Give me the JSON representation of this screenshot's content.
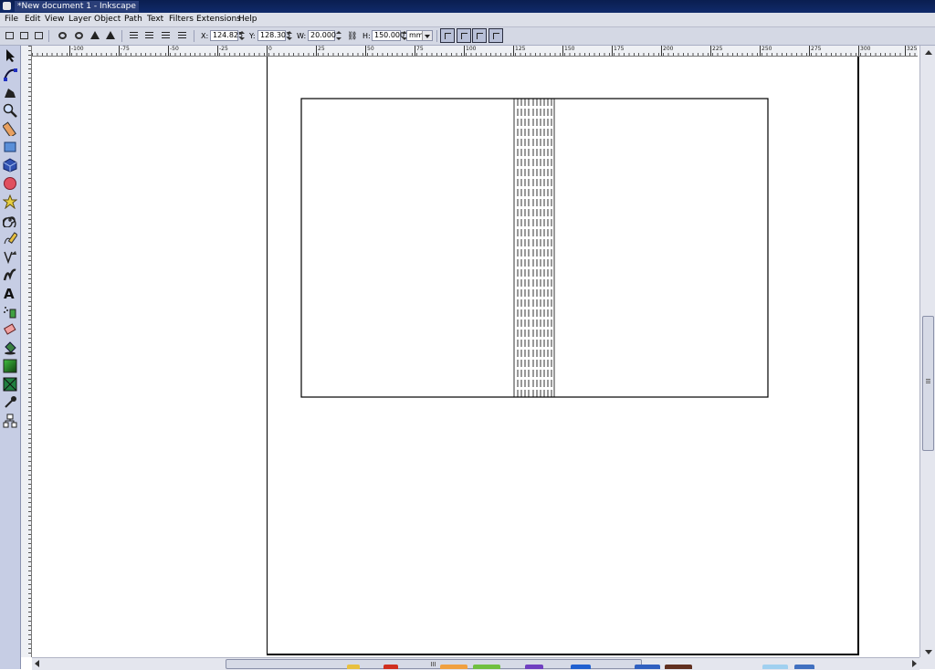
{
  "window": {
    "title": "*New document 1 - Inkscape"
  },
  "menu": [
    "File",
    "Edit",
    "View",
    "Layer",
    "Object",
    "Path",
    "Text",
    "Filters",
    "Extensions",
    "Help"
  ],
  "toolbar": {
    "x_label": "X:",
    "x_value": "124.825",
    "y_label": "Y:",
    "y_value": "128.303",
    "w_label": "W:",
    "w_value": "20.000",
    "h_label": "H:",
    "h_value": "150.000",
    "unit": "mm"
  },
  "tools": [
    "selector-tool",
    "node-tool",
    "tweak-tool",
    "zoom-tool",
    "measure-tool",
    "rectangle-tool",
    "3d-box-tool",
    "ellipse-tool",
    "star-tool",
    "spiral-tool",
    "pencil-tool",
    "pen-tool",
    "calligraphy-tool",
    "text-tool",
    "spray-tool",
    "eraser-tool",
    "paint-bucket-tool",
    "gradient-tool",
    "mesh-tool",
    "dropper-tool",
    "connector-tool"
  ],
  "ruler_labels": [
    "-100",
    "-75",
    "-50",
    "-25",
    "0",
    "25",
    "50",
    "75",
    "100",
    "125",
    "150",
    "175",
    "200",
    "225",
    "250",
    "275",
    "300",
    "325"
  ]
}
